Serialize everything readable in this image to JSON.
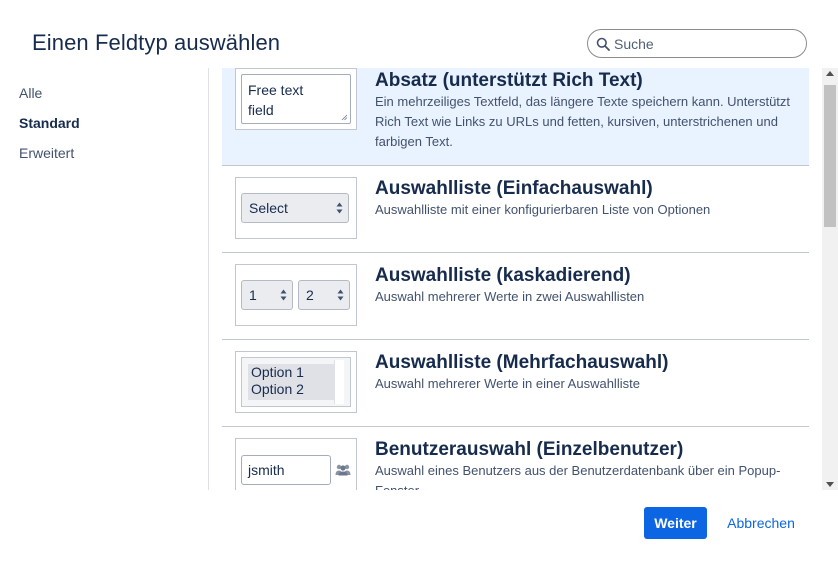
{
  "dialog": {
    "title": "Einen Feldtyp auswählen"
  },
  "search": {
    "placeholder": "Suche",
    "value": ""
  },
  "nav": {
    "items": [
      {
        "label": "Alle",
        "active": false
      },
      {
        "label": "Standard",
        "active": true
      },
      {
        "label": "Erweitert",
        "active": false
      }
    ]
  },
  "field_types": [
    {
      "title": "Absatz (unterstützt Rich Text)",
      "description": "Ein mehrzeiliges Textfeld, das längere Texte speichern kann. Unterstützt Rich Text wie Links zu URLs und fetten, kursiven, unterstrichenen und farbigen Text.",
      "preview": {
        "line1": "Free text",
        "line2": "field"
      },
      "selected": true
    },
    {
      "title": "Auswahlliste (Einfachauswahl)",
      "description": "Auswahlliste mit einer konfigurierbaren Liste von Optionen",
      "preview": {
        "select_label": "Select"
      },
      "selected": false
    },
    {
      "title": "Auswahlliste (kaskadierend)",
      "description": "Auswahl mehrerer Werte in zwei Auswahllisten",
      "preview": {
        "first": "1",
        "second": "2"
      },
      "selected": false
    },
    {
      "title": "Auswahlliste (Mehrfachauswahl)",
      "description": "Auswahl mehrerer Werte in einer Auswahlliste",
      "preview": {
        "option1": "Option 1",
        "option2": "Option 2"
      },
      "selected": false
    },
    {
      "title": "Benutzerauswahl (Einzelbenutzer)",
      "description": "Auswahl eines Benutzers aus der Benutzerdatenbank über ein Popup-Fenster",
      "preview": {
        "username": "jsmith"
      },
      "selected": false
    }
  ],
  "footer": {
    "next_label": "Weiter",
    "cancel_label": "Abbrechen"
  },
  "colors": {
    "primary": "#0c66e4",
    "selected_row": "#e9f2ff",
    "text": "#172b4d"
  }
}
